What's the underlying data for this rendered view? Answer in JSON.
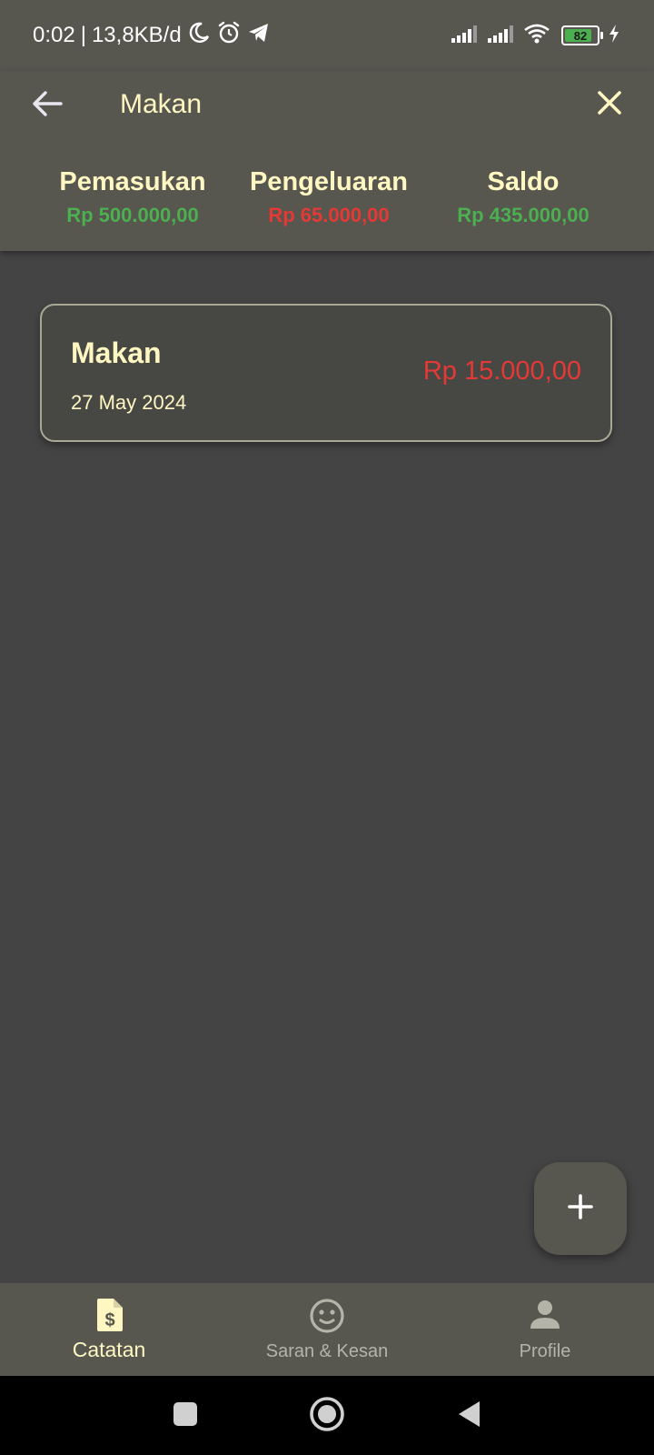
{
  "status_bar": {
    "time": "0:02",
    "separator": "|",
    "network_speed": "13,8KB/d",
    "battery_level": 82,
    "icons_left": [
      "moon-icon",
      "alarm-icon",
      "telegram-icon"
    ],
    "icons_right": [
      "signal-icon",
      "signal-icon",
      "wifi-icon",
      "battery-icon",
      "charging-icon"
    ]
  },
  "app_bar": {
    "search_value": "Makan",
    "back_icon": "arrow-left-icon",
    "close_icon": "close-icon"
  },
  "summary": {
    "income_label": "Pemasukan",
    "income_value": "Rp 500.000,00",
    "expense_label": "Pengeluaran",
    "expense_value": "Rp 65.000,00",
    "balance_label": "Saldo",
    "balance_value": "Rp 435.000,00"
  },
  "transactions": [
    {
      "title": "Makan",
      "date": "27 May 2024",
      "amount": "Rp 15.000,00"
    }
  ],
  "fab": {
    "icon": "plus-icon"
  },
  "bottom_nav": {
    "items": [
      {
        "label": "Catatan",
        "icon": "document-dollar-icon",
        "active": true
      },
      {
        "label": "Saran & Kesan",
        "icon": "smiley-icon",
        "active": false
      },
      {
        "label": "Profile",
        "icon": "person-icon",
        "active": false
      }
    ]
  },
  "system_nav": {
    "icons": [
      "recents-square-icon",
      "home-circle-icon",
      "back-triangle-icon"
    ]
  },
  "colors": {
    "bar_background": "#57564f",
    "body_background": "#444444",
    "accent_text": "#fff7c2",
    "positive": "#4caf50",
    "negative": "#e53935"
  }
}
